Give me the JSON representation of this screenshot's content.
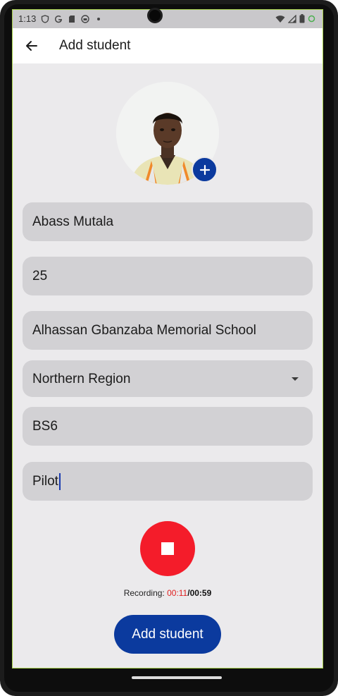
{
  "status_bar": {
    "time": "1:13",
    "icons_left": [
      "shield-icon",
      "google-icon",
      "sd-card-icon",
      "app-icon",
      "dot-icon"
    ],
    "icons_right": [
      "wifi-icon",
      "signal-icon",
      "battery-icon",
      "notification-icon"
    ]
  },
  "app_bar": {
    "back_icon": "arrow-left-icon",
    "title": "Add student"
  },
  "avatar": {
    "add_icon": "plus-icon"
  },
  "form": {
    "name": "Abass Mutala",
    "age": "25",
    "school": "Alhassan Gbanzaba Memorial School",
    "region": "Northern Region",
    "class": "BS6",
    "profession": "Pilot"
  },
  "recording": {
    "label": "Recording: ",
    "elapsed": "00:11",
    "separator": "/",
    "total": "00:59",
    "stop_icon": "stop-icon"
  },
  "submit_label": "Add student",
  "colors": {
    "primary": "#0b3a9e",
    "record": "#f41c2a",
    "field_bg": "#d2d1d4",
    "screen_bg": "#ebeaec"
  }
}
